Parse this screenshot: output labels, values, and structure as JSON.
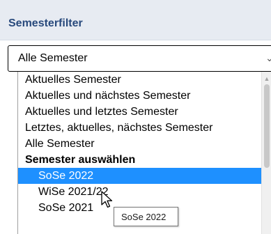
{
  "panel": {
    "title": "Semesterfilter"
  },
  "select": {
    "value": "Alle Semester",
    "chevron_icon": "chevron-down-icon"
  },
  "options": [
    {
      "label": "Aktuelles Semester",
      "kind": "option"
    },
    {
      "label": "Aktuelles und nächstes Semester",
      "kind": "option"
    },
    {
      "label": "Aktuelles und letztes Semester",
      "kind": "option"
    },
    {
      "label": "Letztes, aktuelles, nächstes Semester",
      "kind": "option"
    },
    {
      "label": "Alle Semester",
      "kind": "option"
    },
    {
      "label": "Semester auswählen",
      "kind": "group"
    },
    {
      "label": "SoSe 2022",
      "kind": "sub",
      "highlighted": true
    },
    {
      "label": "WiSe 2021/22",
      "kind": "sub"
    },
    {
      "label": "SoSe 2021",
      "kind": "sub"
    }
  ],
  "tooltip": {
    "text": "SoSe 2022"
  },
  "colors": {
    "header_bg": "#e7ebf2",
    "title_text": "#28497c",
    "highlight": "#1e90ff"
  }
}
